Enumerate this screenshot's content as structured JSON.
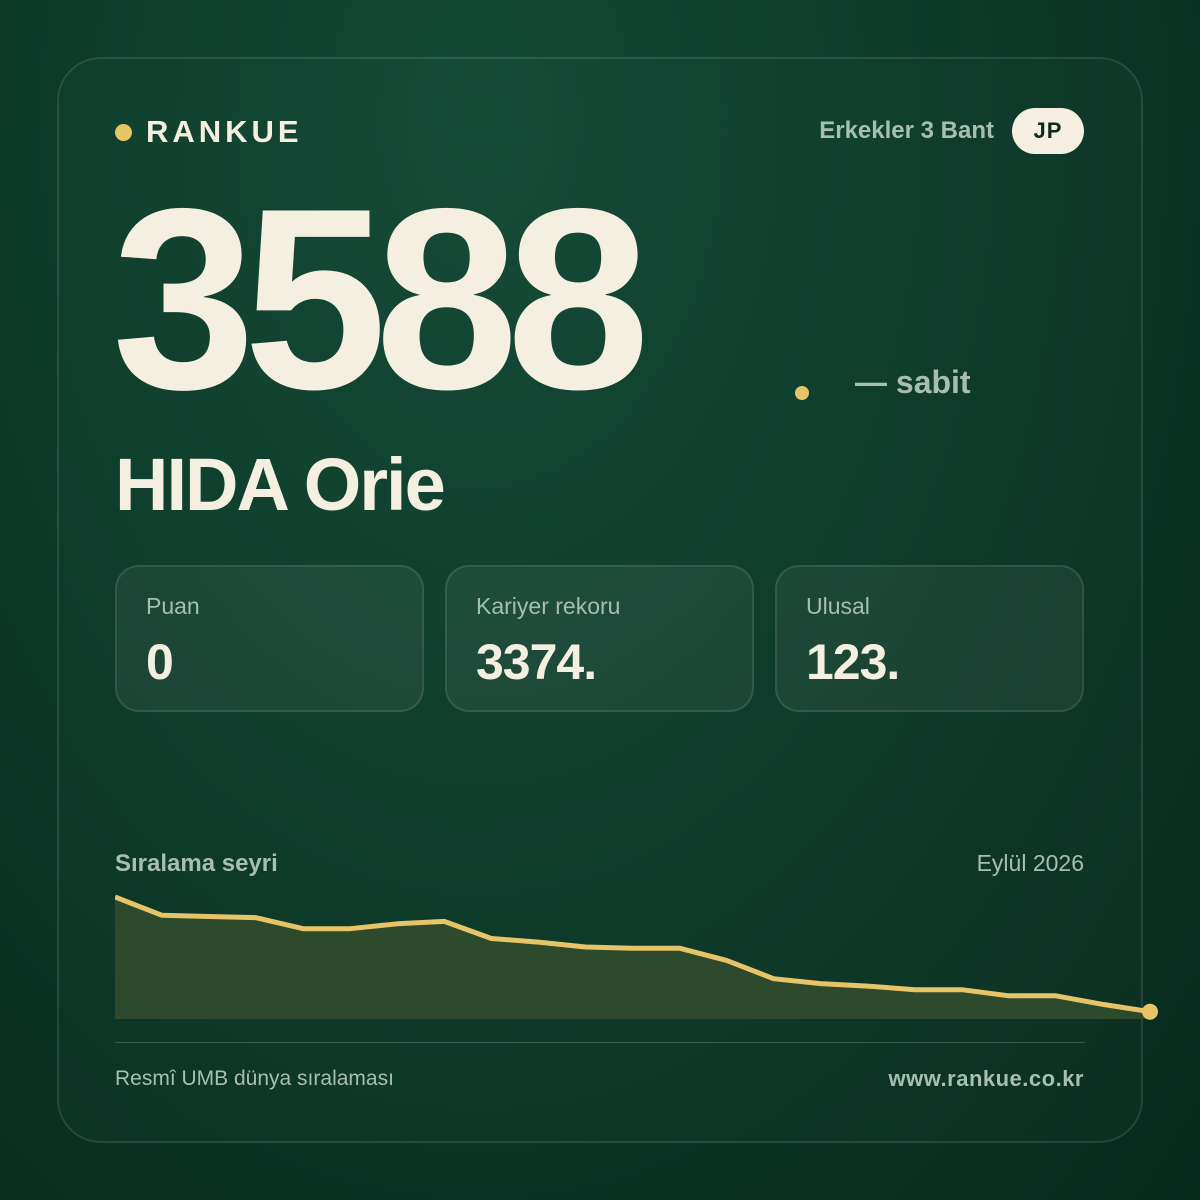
{
  "brand": {
    "name": "RANKUE",
    "accent_color": "#e8c469"
  },
  "header": {
    "category": "Erkekler 3 Bant",
    "country_code": "JP"
  },
  "rank": {
    "value": "3588",
    "dot": ".",
    "trend_text": "— sabit"
  },
  "player": {
    "name": "HIDA Orie"
  },
  "stats": [
    {
      "label": "Puan",
      "value": "0"
    },
    {
      "label": "Kariyer rekoru",
      "value": "3374."
    },
    {
      "label": "Ulusal",
      "value": "123."
    }
  ],
  "chart": {
    "title": "Sıralama seyri",
    "date": "Eylül 2026"
  },
  "chart_data": {
    "type": "area",
    "title": "Sıralama seyri",
    "x": [
      1,
      2,
      3,
      4,
      5,
      6,
      7,
      8,
      9,
      10,
      11,
      12,
      13,
      14,
      15,
      16,
      17,
      18,
      19,
      20,
      21,
      22,
      23
    ],
    "values": [
      1.0,
      0.85,
      0.84,
      0.83,
      0.74,
      0.74,
      0.78,
      0.8,
      0.66,
      0.63,
      0.59,
      0.58,
      0.58,
      0.48,
      0.33,
      0.29,
      0.27,
      0.24,
      0.24,
      0.19,
      0.19,
      0.12,
      0.06
    ],
    "last_value": 0.06,
    "line_color": "#e8c469",
    "fill_color": "#2d4a2c",
    "grid": false,
    "note": "relative rank trajectory, no axes printed"
  },
  "footer": {
    "left": "Resmî UMB dünya sıralaması",
    "right": "www.rankue.co.kr"
  }
}
